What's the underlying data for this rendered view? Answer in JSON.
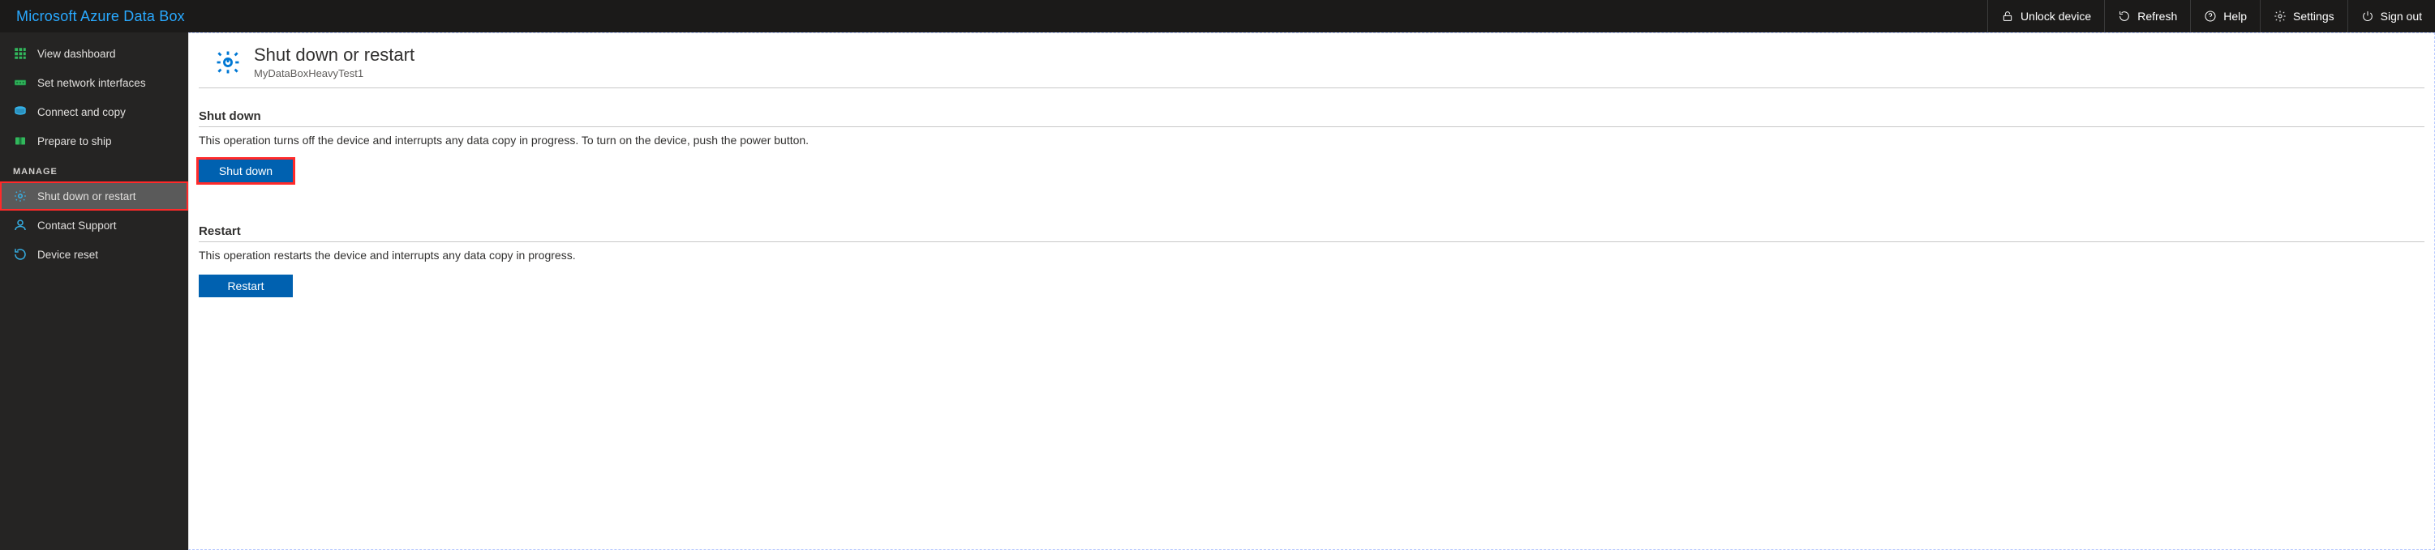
{
  "brand": "Microsoft Azure Data Box",
  "top_actions": {
    "unlock": "Unlock device",
    "refresh": "Refresh",
    "help": "Help",
    "settings": "Settings",
    "signout": "Sign out"
  },
  "sidebar": {
    "items": [
      {
        "label": "View dashboard"
      },
      {
        "label": "Set network interfaces"
      },
      {
        "label": "Connect and copy"
      },
      {
        "label": "Prepare to ship"
      }
    ],
    "manage_header": "MANAGE",
    "manage_items": [
      {
        "label": "Shut down or restart"
      },
      {
        "label": "Contact Support"
      },
      {
        "label": "Device reset"
      }
    ]
  },
  "page": {
    "title": "Shut down or restart",
    "subtitle": "MyDataBoxHeavyTest1"
  },
  "shutdown": {
    "heading": "Shut down",
    "description": "This operation turns off the device and interrupts any data copy in progress. To turn on the device, push the power button.",
    "button": "Shut down"
  },
  "restart": {
    "heading": "Restart",
    "description": "This operation restarts the device and interrupts any data copy in progress.",
    "button": "Restart"
  }
}
